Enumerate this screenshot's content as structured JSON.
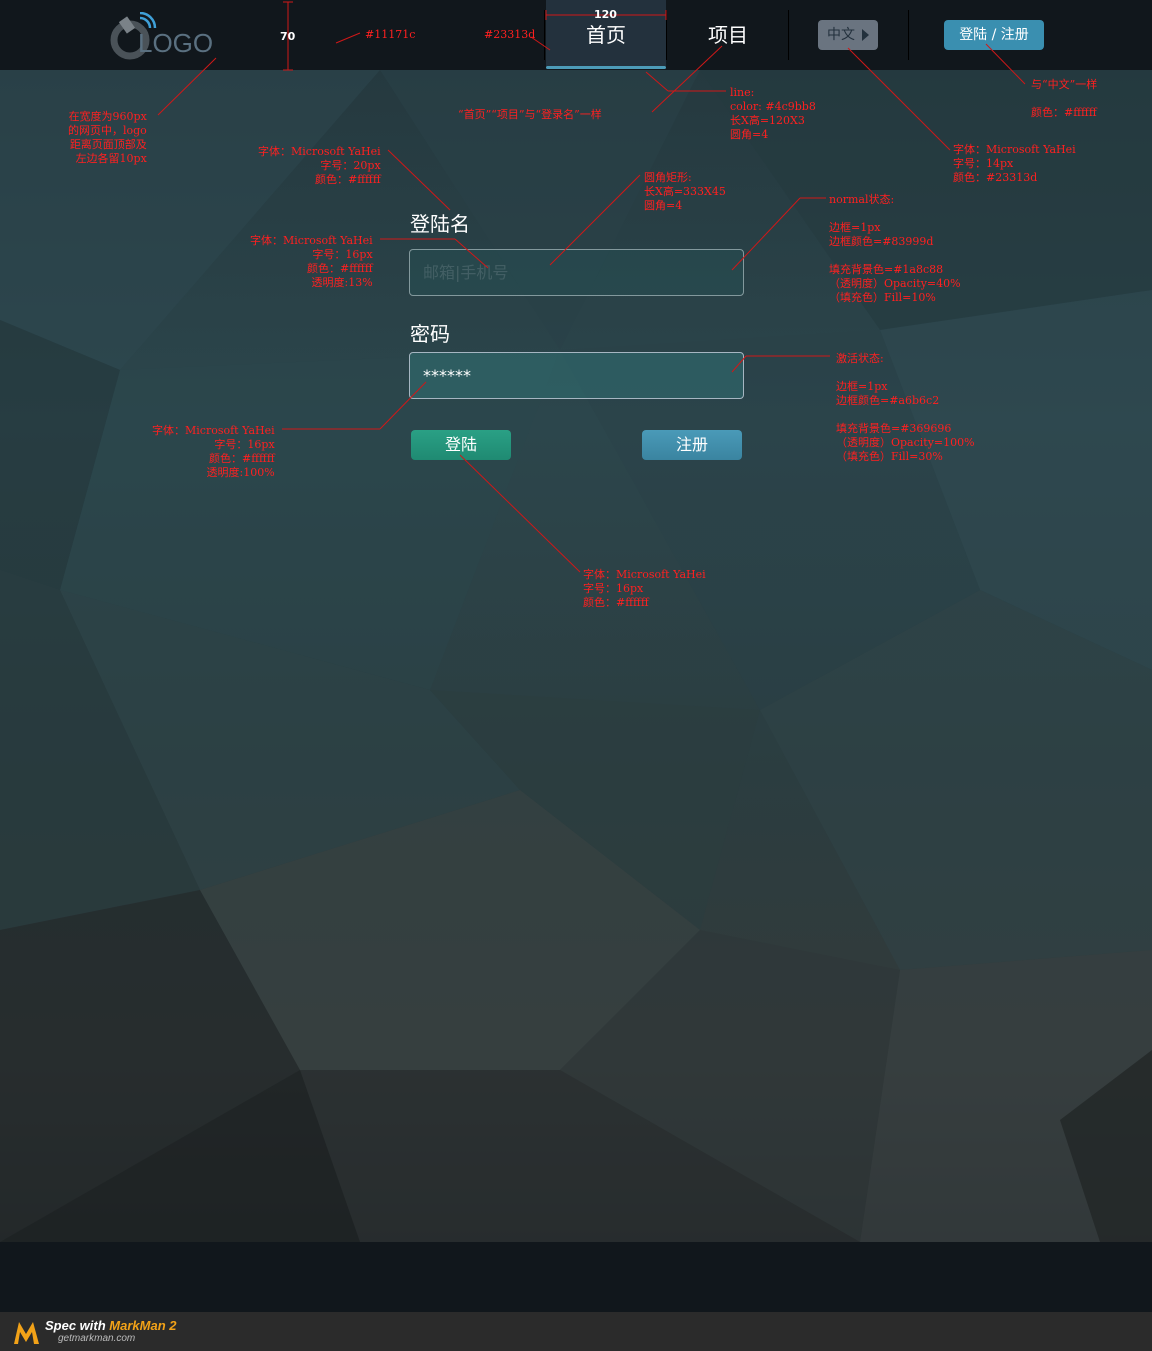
{
  "header": {
    "logo_text": "LOGO",
    "nav": [
      {
        "label": "首页",
        "active": true
      },
      {
        "label": "项目",
        "active": false
      }
    ],
    "lang_button": "中文",
    "login_button": "登陆 / 注册"
  },
  "form": {
    "username_label": "登陆名",
    "username_placeholder": "邮箱|手机号",
    "password_label": "密码",
    "password_value": "******",
    "submit_button": "登陆",
    "register_button": "注册"
  },
  "annotations": {
    "nav_height": "70",
    "nav_width": "120",
    "bg_color": "#11171c",
    "nav_active_color": "#23313d",
    "logo_note": "在宽度为960px\n的网页中，logo\n距离页面顶部及\n左边各留10px",
    "nav_same_note": "“首页”“项目”与“登录名”一样",
    "line_note": "line:\ncolor: #4c9bb8\n长X高=120X3\n圆角=4",
    "lang_note": "字体：Microsoft YaHei\n字号：14px\n颜色：#23313d",
    "login_note": "与“中文”一样\n\n颜色：#ffffff",
    "label_note": "字体：Microsoft YaHei\n字号：20px\n颜色：#ffffff",
    "placeholder_note": "字体：Microsoft YaHei\n字号：16px\n颜色：#ffffff\n透明度:13%",
    "rect_note": "圆角矩形:\n长X高=333X45\n圆角=4",
    "normal_note": "normal状态:\n\n边框=1px\n边框颜色=#83999d\n\n填充背景色=#1a8c88\n（透明度）Opacity=40%\n（填充色）Fill=10%",
    "active_note": "激活状态:\n\n边框=1px\n边框颜色=#a6b6c2\n\n填充背景色=#369696\n（透明度）Opacity=100%\n（填充色）Fill=30%",
    "password_note": "字体：Microsoft YaHei\n字号：16px\n颜色：#ffffff\n透明度:100%",
    "button_note": "字体：Microsoft YaHei\n字号：16px\n颜色：#ffffff"
  },
  "footer": {
    "spec_prefix": "Spec with ",
    "spec_brand": "MarkMan 2",
    "spec_url": "getmarkman.com"
  }
}
